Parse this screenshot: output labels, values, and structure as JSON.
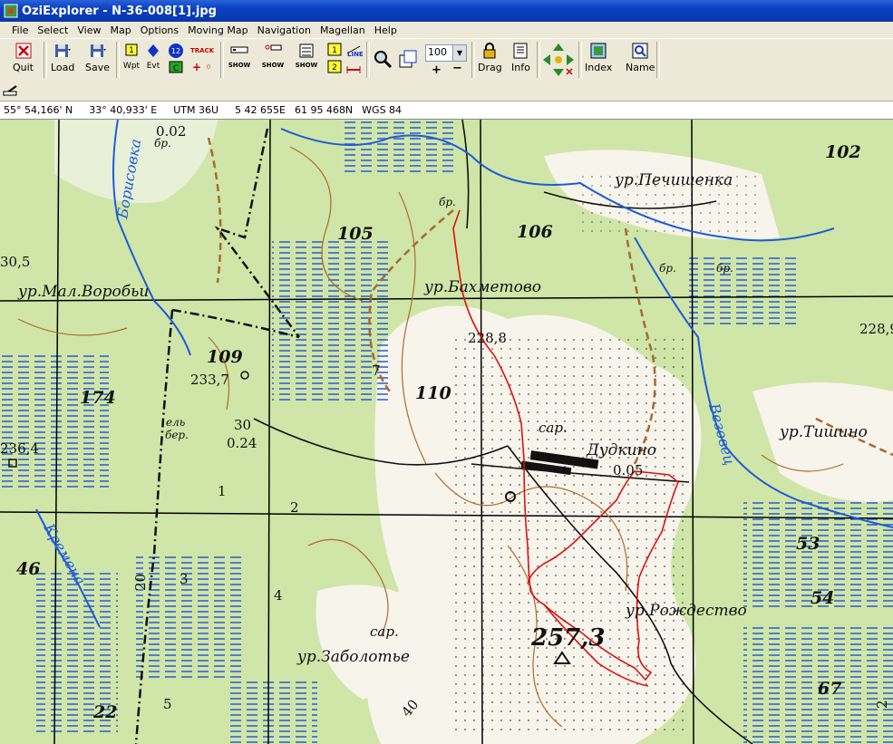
{
  "window": {
    "title": "OziExplorer - N-36-008[1].jpg"
  },
  "menu": [
    "File",
    "Select",
    "View",
    "Map",
    "Options",
    "Moving Map",
    "Navigation",
    "Magellan",
    "Help"
  ],
  "toolbar": {
    "quit": "Quit",
    "load": "Load",
    "save": "Save",
    "wpt": "Wpt",
    "evt": "Evt",
    "track": "TRACK",
    "show": "SHOW",
    "line": "LINE",
    "zoom_value": "100",
    "drag": "Drag",
    "info": "Info",
    "index": "Index",
    "name": "Name"
  },
  "status": {
    "lat": "55° 54,166' N",
    "lon": "33° 40,933' E",
    "utm_zone": "UTM  36U",
    "easting": "5 42 655E",
    "northing": "61 95 468N",
    "datum": "WGS 84"
  },
  "map_labels": {
    "bakhmetovo": "ур.Бахметово",
    "pechishenka": "ур.Печишенка",
    "mal_vorobyi": "ур.Мал.Воробьи",
    "dudkino": "Дудкино",
    "rozhdestvo": "ур.Рождество",
    "zabolotye": "ур.Заболотье",
    "tishino": "ур.Тишино",
    "borisovka": "Борисовка",
    "kremena": "Кремена",
    "vezovets": "Везовец",
    "sar1": "сар.",
    "sar2": "сар.",
    "br1": "бр.",
    "br2": "бр.",
    "br3": "бр.",
    "br4": "бр.",
    "el_ber": "ель",
    "ber": "бер.",
    "h105": "105",
    "h106": "106",
    "h102": "102",
    "h110": "110",
    "h109": "109",
    "h174": "174",
    "h228_8": "228,8",
    "h233_7": "233,7",
    "h236_4": "236,4",
    "h257_3": "257,3",
    "h228_9": "228,9",
    "h30_5": "30,5",
    "h0_02": "0.02",
    "h0_05": "0.05",
    "h30": "30",
    "h0_24": "0.24",
    "n46": "46",
    "n53": "53",
    "n54": "54",
    "n67": "67",
    "n22": "22",
    "n5": "5",
    "n4": "4",
    "n1": "1",
    "n2": "2",
    "n3": "3",
    "n7": "7",
    "n20": "20",
    "n40": "40",
    "n2_r": "2"
  },
  "colors": {
    "title_bar": "#0a3fc0",
    "map_bg": "#cfe6a8",
    "water": "#1e5cd8",
    "track": "#e01010",
    "contour": "#b06a2a"
  }
}
